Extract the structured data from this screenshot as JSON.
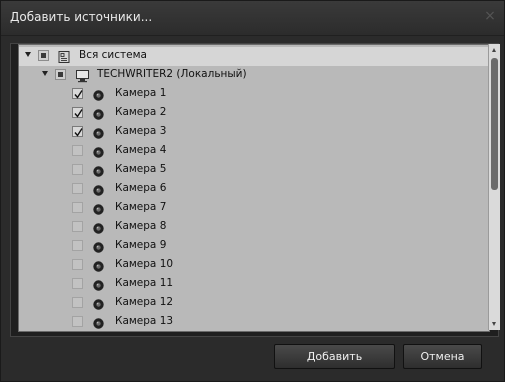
{
  "dialog": {
    "title": "Добавить источники...",
    "close_symbol": "×"
  },
  "tree": {
    "root": {
      "label": "Вся система",
      "state": "partial"
    },
    "server": {
      "label": "TECHWRITER2 (Локальный)",
      "state": "partial"
    },
    "cameras": [
      {
        "label": "Камера 1",
        "checked": true
      },
      {
        "label": "Камера 2",
        "checked": true
      },
      {
        "label": "Камера 3",
        "checked": true
      },
      {
        "label": "Камера 4",
        "checked": false
      },
      {
        "label": "Камера 5",
        "checked": false
      },
      {
        "label": "Камера 6",
        "checked": false
      },
      {
        "label": "Камера 7",
        "checked": false
      },
      {
        "label": "Камера 8",
        "checked": false
      },
      {
        "label": "Камера 9",
        "checked": false
      },
      {
        "label": "Камера 10",
        "checked": false
      },
      {
        "label": "Камера 11",
        "checked": false
      },
      {
        "label": "Камера 12",
        "checked": false
      },
      {
        "label": "Камера 13",
        "checked": false
      }
    ]
  },
  "buttons": {
    "add_label": "Добавить",
    "cancel_label": "Отмена"
  }
}
